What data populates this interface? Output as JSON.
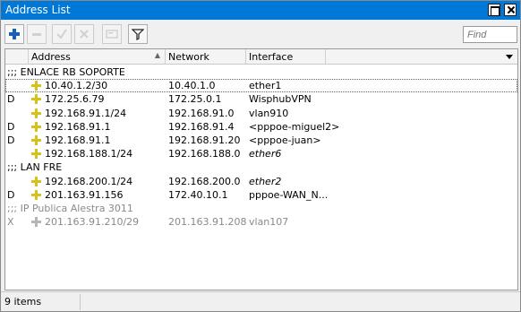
{
  "window": {
    "title": "Address List"
  },
  "toolbar": {
    "find_placeholder": "Find"
  },
  "columns": {
    "address": "Address",
    "network": "Network",
    "interface": "Interface"
  },
  "rows": [
    {
      "type": "comment",
      "text": ";;; ENLACE RB SOPORTE"
    },
    {
      "type": "entry",
      "flag": "",
      "address": "10.40.1.2/30",
      "network": "10.40.1.0",
      "interface": "ether1",
      "interface_italic": false,
      "selected": true
    },
    {
      "type": "entry",
      "flag": "D",
      "address": "172.25.6.79",
      "network": "172.25.0.1",
      "interface": "WisphubVPN",
      "interface_italic": false
    },
    {
      "type": "entry",
      "flag": "",
      "address": "192.168.91.1/24",
      "network": "192.168.91.0",
      "interface": "vlan910",
      "interface_italic": false
    },
    {
      "type": "entry",
      "flag": "D",
      "address": "192.168.91.1",
      "network": "192.168.91.4",
      "interface": "<pppoe-miguel2>",
      "interface_italic": false
    },
    {
      "type": "entry",
      "flag": "D",
      "address": "192.168.91.1",
      "network": "192.168.91.20",
      "interface": "<pppoe-juan>",
      "interface_italic": false
    },
    {
      "type": "entry",
      "flag": "",
      "address": "192.168.188.1/24",
      "network": "192.168.188.0",
      "interface": "ether6",
      "interface_italic": true
    },
    {
      "type": "comment",
      "text": ";;; LAN FRE"
    },
    {
      "type": "entry",
      "flag": "",
      "address": "192.168.200.1/24",
      "network": "192.168.200.0",
      "interface": "ether2",
      "interface_italic": true
    },
    {
      "type": "entry",
      "flag": "D",
      "address": "201.163.91.156",
      "network": "172.40.10.1",
      "interface": "pppoe-WAN_N...",
      "interface_italic": false
    },
    {
      "type": "comment",
      "text": ";;; IP Publica Alestra 3011",
      "disabled": true
    },
    {
      "type": "entry",
      "flag": "X",
      "address": "201.163.91.210/29",
      "network": "201.163.91.208",
      "interface": "vlan107",
      "interface_italic": false,
      "disabled": true
    }
  ],
  "status": {
    "items_text": "9 items"
  },
  "colors": {
    "titlebar": "#0078d7",
    "add_icon": "#1a5fb4",
    "address_icon": "#d4c21a",
    "disabled_text": "#8a8a8a"
  }
}
